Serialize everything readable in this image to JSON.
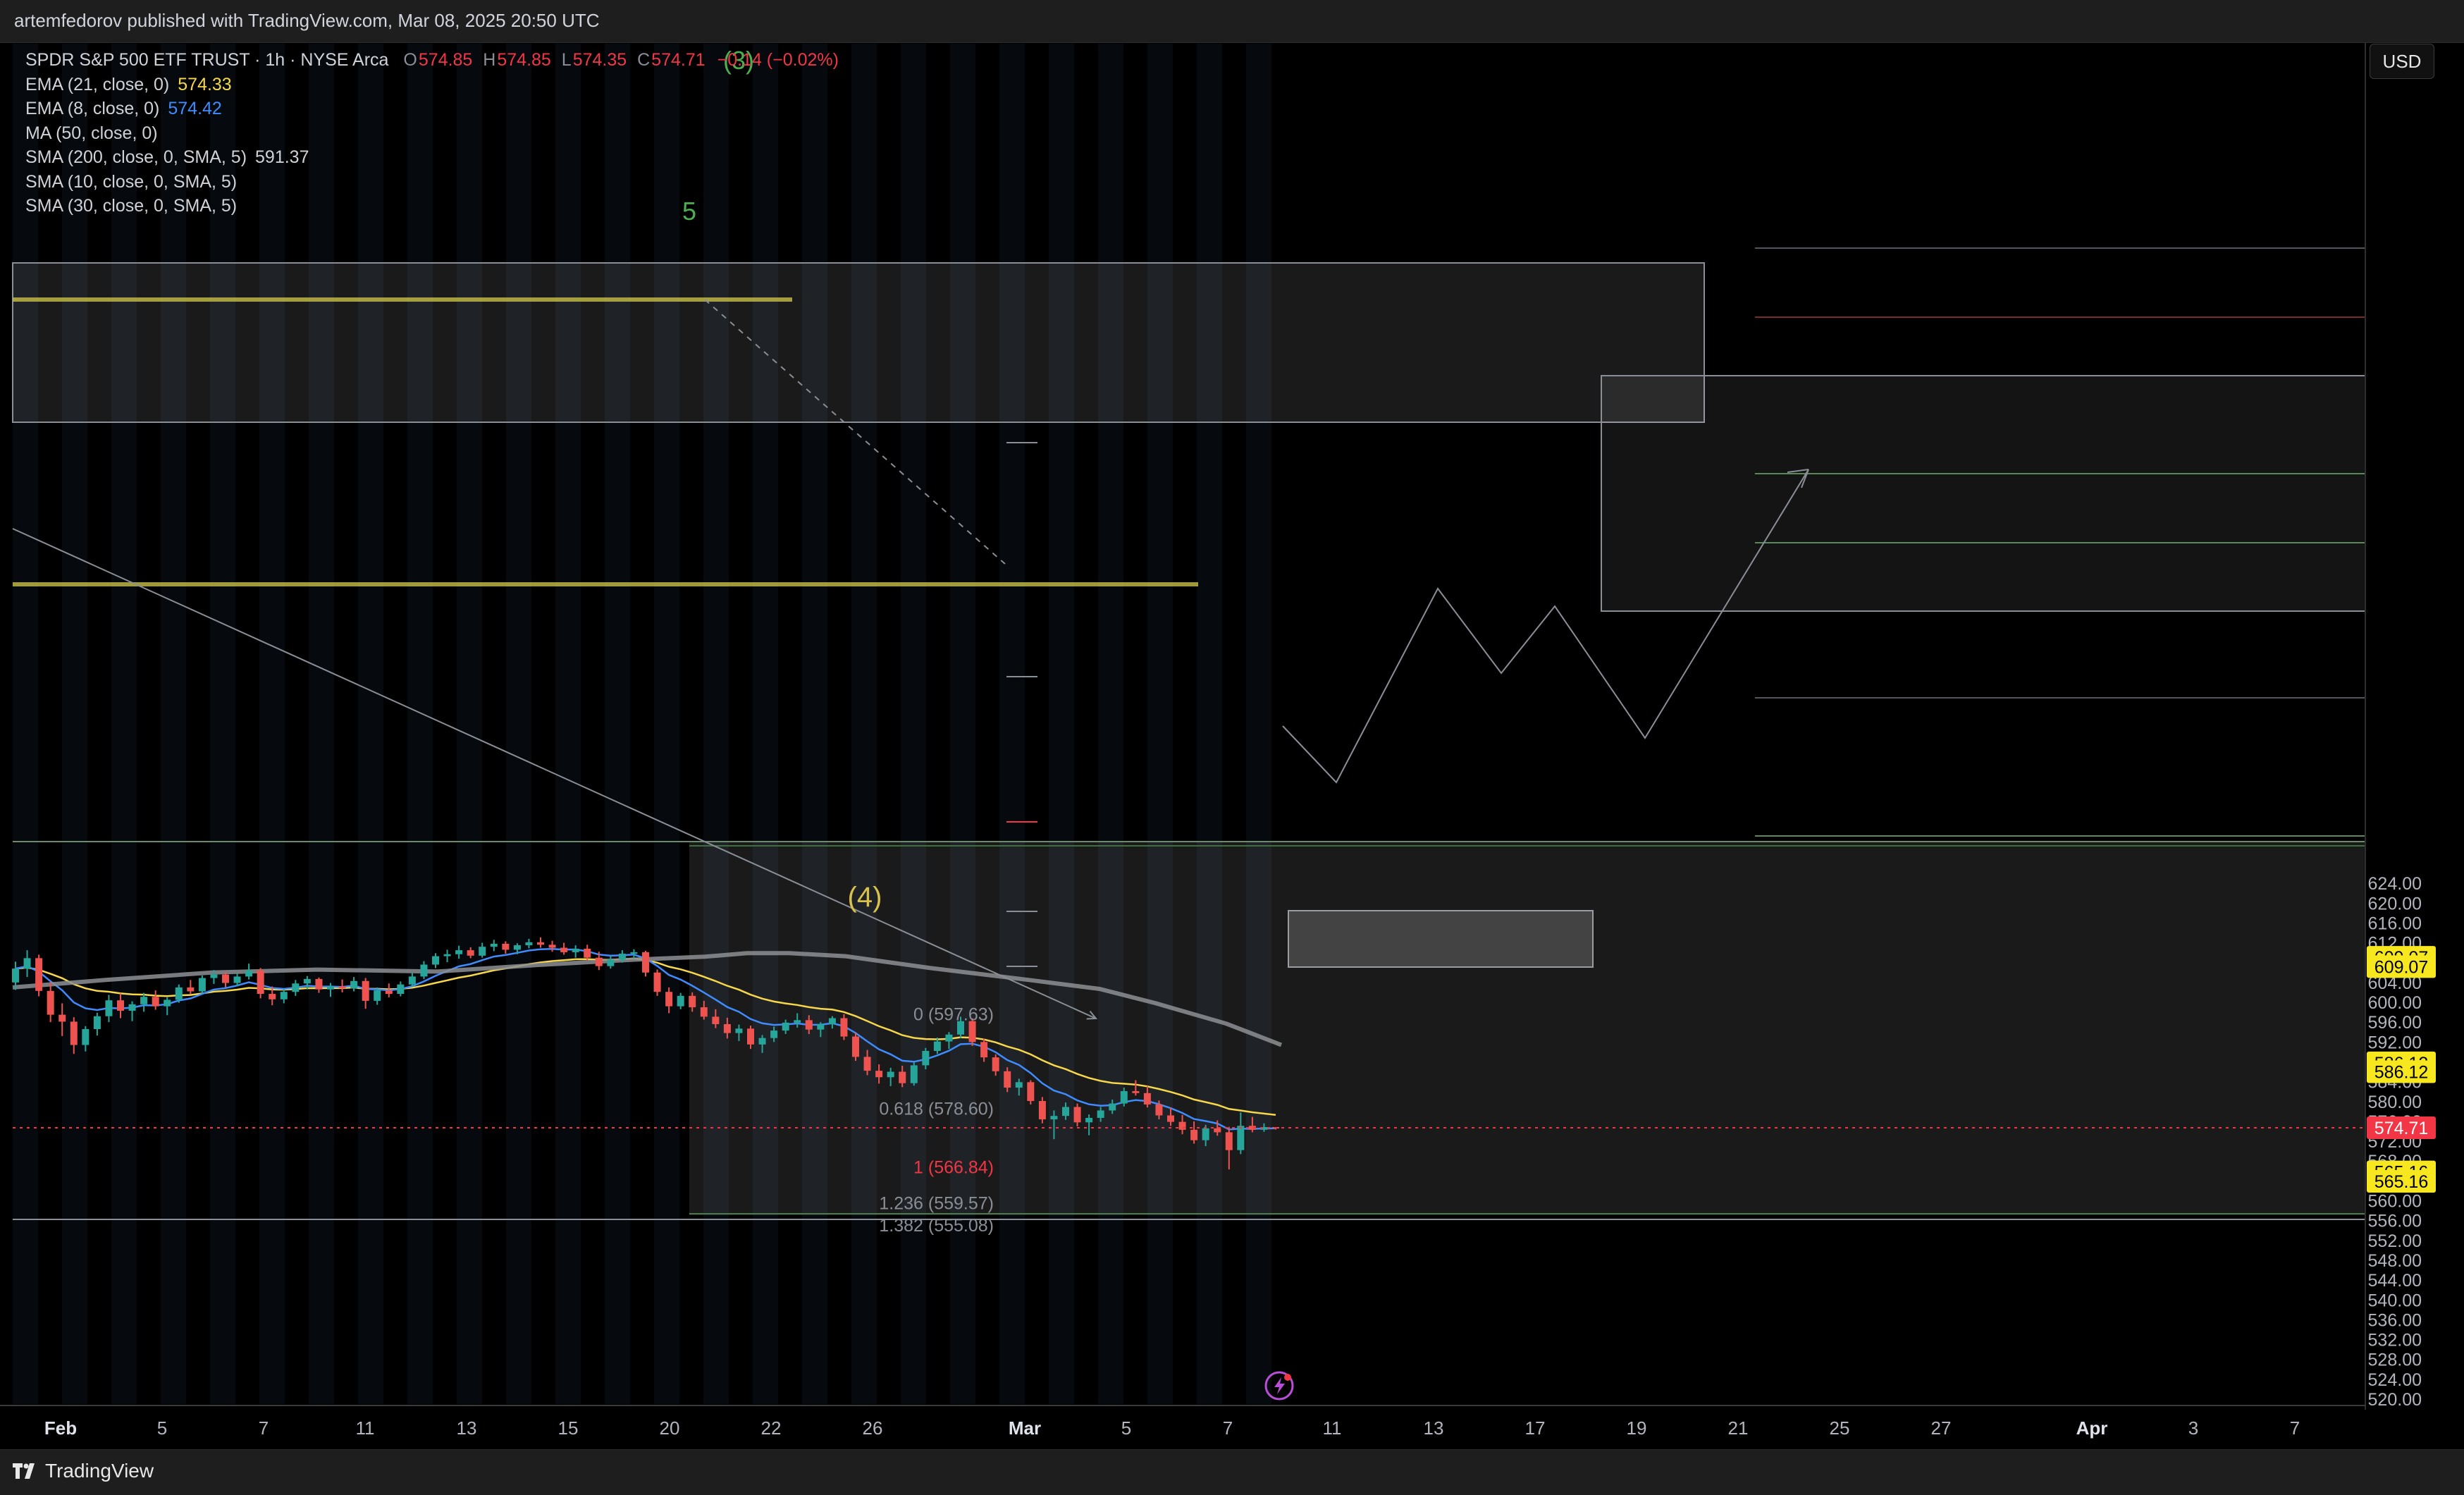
{
  "header": {
    "published": "artemfedorov published with TradingView.com, Mar 08, 2025 20:50 UTC"
  },
  "symbol": {
    "title": "SPDR S&P 500 ETF TRUST · 1h · NYSE Arca",
    "open_label": "O",
    "open": "574.85",
    "high_label": "H",
    "high": "574.85",
    "low_label": "L",
    "low": "574.35",
    "close_label": "C",
    "close": "574.71",
    "change": "−0.14 (−0.02%)"
  },
  "indicators": [
    {
      "label": "EMA (21, close, 0)",
      "value": "574.33"
    },
    {
      "label": "EMA (8, close, 0)",
      "value": "574.42"
    },
    {
      "label": "MA (50, close, 0)",
      "value": ""
    },
    {
      "label": "SMA (200, close, 0, SMA, 5)",
      "value": "591.37"
    },
    {
      "label": "SMA (10, close, 0, SMA, 5)",
      "value": ""
    },
    {
      "label": "SMA (30, close, 0, SMA, 5)",
      "value": ""
    }
  ],
  "currency_button": "USD",
  "colors": {
    "up": "#26a69a",
    "down": "#ef5350",
    "ema21": "#f7d74a",
    "ema8": "#3f8cff",
    "sma200": "#8d8f94",
    "resistance": "#c8c04a",
    "label_yellow": "#f6e71e",
    "price_red": "#f23645",
    "wave_green": "#4caf50",
    "fib_red": "#f23645"
  },
  "chart_data": {
    "type": "candlestick",
    "ylim": [
      518,
      628
    ],
    "y_ticks": [
      "624.00",
      "620.00",
      "616.00",
      "612.00",
      "608.00",
      "604.00",
      "600.00",
      "596.00",
      "592.00",
      "588.00",
      "584.00",
      "580.00",
      "576.00",
      "572.00",
      "568.00",
      "564.00",
      "560.00",
      "556.00",
      "552.00",
      "548.00",
      "544.00",
      "540.00",
      "536.00",
      "532.00",
      "528.00",
      "524.00",
      "520.00"
    ],
    "x_ticks": [
      "Feb",
      "5",
      "7",
      "11",
      "13",
      "15",
      "20",
      "22",
      "26",
      "Mar",
      "5",
      "7",
      "11",
      "13",
      "17",
      "19",
      "21",
      "25",
      "27",
      "Apr",
      "3",
      "7"
    ],
    "last_price": 574.71,
    "price_badges": [
      {
        "value": "609.07",
        "price": 609.07,
        "style": "yellow"
      },
      {
        "value": "609.07",
        "price": 607.2,
        "style": "yellow"
      },
      {
        "value": "586.12",
        "price": 587.8,
        "style": "yellow"
      },
      {
        "value": "586.12",
        "price": 586.0,
        "style": "yellow"
      },
      {
        "value": "574.71",
        "price": 574.71,
        "style": "red"
      },
      {
        "value": "565.16",
        "price": 565.8,
        "style": "yellow"
      },
      {
        "value": "565.16",
        "price": 563.9,
        "style": "yellow"
      }
    ],
    "fib_labels": [
      {
        "text": "0 (597.63)",
        "price": 597.63,
        "style": "gray"
      },
      {
        "text": "0.618 (578.60)",
        "price": 578.6,
        "style": "gray"
      },
      {
        "text": "1 (566.84)",
        "price": 566.84,
        "style": "red"
      },
      {
        "text": "1.236 (559.57)",
        "price": 559.57,
        "style": "gray"
      },
      {
        "text": "1.382 (555.08)",
        "price": 555.08,
        "style": "gray"
      }
    ],
    "wave_labels": [
      {
        "text": "(3)",
        "style": "green"
      },
      {
        "text": "5",
        "style": "green"
      },
      {
        "text": "(4)",
        "style": "yellow"
      }
    ],
    "ohlc": [
      {
        "o": 604.0,
        "h": 608.2,
        "l": 602.5,
        "c": 606.8
      },
      {
        "o": 606.8,
        "h": 610.5,
        "l": 605.1,
        "c": 608.9
      },
      {
        "o": 608.9,
        "h": 609.6,
        "l": 601.2,
        "c": 602.3
      },
      {
        "o": 602.3,
        "h": 604.1,
        "l": 596.0,
        "c": 597.5
      },
      {
        "o": 597.5,
        "h": 599.8,
        "l": 593.2,
        "c": 596.1
      },
      {
        "o": 596.1,
        "h": 597.0,
        "l": 589.6,
        "c": 591.4
      },
      {
        "o": 591.4,
        "h": 595.2,
        "l": 590.1,
        "c": 594.6
      },
      {
        "o": 594.6,
        "h": 597.9,
        "l": 593.3,
        "c": 597.2
      },
      {
        "o": 597.2,
        "h": 601.5,
        "l": 596.0,
        "c": 600.4
      },
      {
        "o": 600.4,
        "h": 601.8,
        "l": 596.8,
        "c": 598.3
      },
      {
        "o": 598.3,
        "h": 600.2,
        "l": 596.2,
        "c": 599.6
      },
      {
        "o": 599.6,
        "h": 601.9,
        "l": 598.1,
        "c": 601.1
      },
      {
        "o": 601.1,
        "h": 602.4,
        "l": 598.5,
        "c": 599.2
      },
      {
        "o": 599.2,
        "h": 601.0,
        "l": 597.4,
        "c": 600.5
      },
      {
        "o": 600.5,
        "h": 603.6,
        "l": 599.9,
        "c": 603.0
      },
      {
        "o": 603.0,
        "h": 604.5,
        "l": 601.6,
        "c": 602.2
      },
      {
        "o": 602.2,
        "h": 605.4,
        "l": 601.8,
        "c": 604.9
      },
      {
        "o": 604.9,
        "h": 606.5,
        "l": 603.7,
        "c": 605.6
      },
      {
        "o": 605.6,
        "h": 606.1,
        "l": 603.0,
        "c": 603.9
      },
      {
        "o": 603.9,
        "h": 605.8,
        "l": 603.2,
        "c": 605.2
      },
      {
        "o": 605.2,
        "h": 607.8,
        "l": 604.6,
        "c": 606.4
      },
      {
        "o": 606.4,
        "h": 606.9,
        "l": 600.8,
        "c": 601.7
      },
      {
        "o": 601.7,
        "h": 603.2,
        "l": 599.4,
        "c": 600.6
      },
      {
        "o": 600.6,
        "h": 602.7,
        "l": 599.8,
        "c": 602.1
      },
      {
        "o": 602.1,
        "h": 604.5,
        "l": 601.3,
        "c": 603.8
      },
      {
        "o": 603.8,
        "h": 605.3,
        "l": 602.6,
        "c": 604.7
      },
      {
        "o": 604.7,
        "h": 605.0,
        "l": 601.9,
        "c": 602.6
      },
      {
        "o": 602.6,
        "h": 603.9,
        "l": 601.1,
        "c": 603.2
      },
      {
        "o": 603.2,
        "h": 604.6,
        "l": 602.0,
        "c": 602.8
      },
      {
        "o": 602.8,
        "h": 605.1,
        "l": 602.2,
        "c": 604.3
      },
      {
        "o": 604.3,
        "h": 604.9,
        "l": 598.7,
        "c": 600.3
      },
      {
        "o": 600.3,
        "h": 603.0,
        "l": 599.5,
        "c": 602.4
      },
      {
        "o": 602.4,
        "h": 603.8,
        "l": 601.0,
        "c": 601.7
      },
      {
        "o": 601.7,
        "h": 604.2,
        "l": 601.2,
        "c": 603.6
      },
      {
        "o": 603.6,
        "h": 605.9,
        "l": 603.1,
        "c": 605.2
      },
      {
        "o": 605.2,
        "h": 608.3,
        "l": 604.7,
        "c": 607.6
      },
      {
        "o": 607.6,
        "h": 609.9,
        "l": 606.9,
        "c": 609.3
      },
      {
        "o": 609.3,
        "h": 610.6,
        "l": 608.1,
        "c": 609.7
      },
      {
        "o": 609.7,
        "h": 611.4,
        "l": 608.8,
        "c": 610.5
      },
      {
        "o": 610.5,
        "h": 611.1,
        "l": 608.9,
        "c": 609.4
      },
      {
        "o": 609.4,
        "h": 612.0,
        "l": 609.0,
        "c": 611.2
      },
      {
        "o": 611.2,
        "h": 612.6,
        "l": 610.3,
        "c": 611.8
      },
      {
        "o": 611.8,
        "h": 612.3,
        "l": 609.8,
        "c": 610.6
      },
      {
        "o": 610.6,
        "h": 611.9,
        "l": 609.7,
        "c": 611.5
      },
      {
        "o": 611.5,
        "h": 612.8,
        "l": 610.9,
        "c": 612.1
      },
      {
        "o": 612.1,
        "h": 613.1,
        "l": 611.0,
        "c": 611.6
      },
      {
        "o": 611.6,
        "h": 612.4,
        "l": 610.2,
        "c": 611.0
      },
      {
        "o": 611.0,
        "h": 612.0,
        "l": 609.6,
        "c": 610.1
      },
      {
        "o": 610.1,
        "h": 611.5,
        "l": 609.0,
        "c": 610.8
      },
      {
        "o": 610.8,
        "h": 611.6,
        "l": 608.4,
        "c": 609.0
      },
      {
        "o": 609.0,
        "h": 610.2,
        "l": 606.5,
        "c": 607.3
      },
      {
        "o": 607.3,
        "h": 609.4,
        "l": 606.8,
        "c": 608.6
      },
      {
        "o": 608.6,
        "h": 610.5,
        "l": 608.0,
        "c": 609.8
      },
      {
        "o": 609.8,
        "h": 610.7,
        "l": 608.8,
        "c": 610.1
      },
      {
        "o": 610.1,
        "h": 610.4,
        "l": 605.2,
        "c": 606.0
      },
      {
        "o": 606.0,
        "h": 606.6,
        "l": 601.3,
        "c": 602.1
      },
      {
        "o": 602.1,
        "h": 603.0,
        "l": 597.8,
        "c": 599.2
      },
      {
        "o": 599.2,
        "h": 601.9,
        "l": 598.6,
        "c": 601.3
      },
      {
        "o": 601.3,
        "h": 602.0,
        "l": 598.1,
        "c": 599.0
      },
      {
        "o": 599.0,
        "h": 600.3,
        "l": 596.5,
        "c": 597.1
      },
      {
        "o": 597.1,
        "h": 598.6,
        "l": 594.8,
        "c": 595.6
      },
      {
        "o": 595.6,
        "h": 596.9,
        "l": 592.7,
        "c": 593.8
      },
      {
        "o": 593.8,
        "h": 595.5,
        "l": 592.2,
        "c": 594.7
      },
      {
        "o": 594.7,
        "h": 595.3,
        "l": 590.6,
        "c": 591.5
      },
      {
        "o": 591.5,
        "h": 593.4,
        "l": 589.8,
        "c": 592.8
      },
      {
        "o": 592.8,
        "h": 595.1,
        "l": 592.0,
        "c": 594.3
      },
      {
        "o": 594.3,
        "h": 596.5,
        "l": 593.6,
        "c": 595.9
      },
      {
        "o": 595.9,
        "h": 597.8,
        "l": 594.9,
        "c": 596.4
      },
      {
        "o": 596.4,
        "h": 597.4,
        "l": 593.6,
        "c": 594.5
      },
      {
        "o": 594.5,
        "h": 596.0,
        "l": 593.0,
        "c": 595.6
      },
      {
        "o": 595.6,
        "h": 597.2,
        "l": 594.7,
        "c": 596.8
      },
      {
        "o": 596.8,
        "h": 597.6,
        "l": 592.4,
        "c": 593.1
      },
      {
        "o": 593.1,
        "h": 593.9,
        "l": 588.2,
        "c": 589.0
      },
      {
        "o": 589.0,
        "h": 590.4,
        "l": 585.3,
        "c": 586.2
      },
      {
        "o": 586.2,
        "h": 587.5,
        "l": 583.6,
        "c": 584.9
      },
      {
        "o": 584.9,
        "h": 586.8,
        "l": 583.1,
        "c": 586.0
      },
      {
        "o": 586.0,
        "h": 587.2,
        "l": 582.9,
        "c": 583.7
      },
      {
        "o": 583.7,
        "h": 587.9,
        "l": 583.2,
        "c": 587.3
      },
      {
        "o": 587.3,
        "h": 590.8,
        "l": 586.5,
        "c": 590.2
      },
      {
        "o": 590.2,
        "h": 592.9,
        "l": 589.6,
        "c": 592.1
      },
      {
        "o": 592.1,
        "h": 594.0,
        "l": 590.6,
        "c": 593.5
      },
      {
        "o": 593.5,
        "h": 597.1,
        "l": 592.8,
        "c": 596.2
      },
      {
        "o": 596.2,
        "h": 596.8,
        "l": 591.2,
        "c": 592.0
      },
      {
        "o": 592.0,
        "h": 592.7,
        "l": 588.0,
        "c": 588.9
      },
      {
        "o": 588.9,
        "h": 589.5,
        "l": 585.2,
        "c": 586.1
      },
      {
        "o": 586.1,
        "h": 586.9,
        "l": 581.9,
        "c": 582.8
      },
      {
        "o": 582.8,
        "h": 584.6,
        "l": 581.2,
        "c": 583.9
      },
      {
        "o": 583.9,
        "h": 584.3,
        "l": 579.4,
        "c": 580.1
      },
      {
        "o": 580.1,
        "h": 580.9,
        "l": 575.6,
        "c": 576.4
      },
      {
        "o": 576.4,
        "h": 578.2,
        "l": 572.4,
        "c": 577.1
      },
      {
        "o": 577.1,
        "h": 579.8,
        "l": 576.3,
        "c": 578.9
      },
      {
        "o": 578.9,
        "h": 579.6,
        "l": 575.0,
        "c": 575.8
      },
      {
        "o": 575.8,
        "h": 577.4,
        "l": 573.2,
        "c": 576.7
      },
      {
        "o": 576.7,
        "h": 578.9,
        "l": 575.9,
        "c": 578.2
      },
      {
        "o": 578.2,
        "h": 580.4,
        "l": 577.5,
        "c": 579.6
      },
      {
        "o": 579.6,
        "h": 582.8,
        "l": 579.0,
        "c": 582.1
      },
      {
        "o": 582.1,
        "h": 584.3,
        "l": 581.2,
        "c": 581.7
      },
      {
        "o": 581.7,
        "h": 583.1,
        "l": 578.8,
        "c": 579.4
      },
      {
        "o": 579.4,
        "h": 580.2,
        "l": 576.4,
        "c": 577.2
      },
      {
        "o": 577.2,
        "h": 578.8,
        "l": 575.1,
        "c": 575.9
      },
      {
        "o": 575.9,
        "h": 577.3,
        "l": 573.4,
        "c": 574.3
      },
      {
        "o": 574.3,
        "h": 576.0,
        "l": 571.5,
        "c": 572.2
      },
      {
        "o": 572.2,
        "h": 575.3,
        "l": 571.0,
        "c": 574.6
      },
      {
        "o": 574.6,
        "h": 576.2,
        "l": 573.1,
        "c": 573.8
      },
      {
        "o": 573.8,
        "h": 574.9,
        "l": 566.3,
        "c": 570.2
      },
      {
        "o": 570.2,
        "h": 577.8,
        "l": 569.4,
        "c": 575.1
      },
      {
        "o": 575.1,
        "h": 576.9,
        "l": 573.8,
        "c": 574.3
      },
      {
        "o": 574.3,
        "h": 575.6,
        "l": 573.9,
        "c": 574.85
      },
      {
        "o": 574.85,
        "h": 574.85,
        "l": 574.35,
        "c": 574.71
      }
    ]
  }
}
